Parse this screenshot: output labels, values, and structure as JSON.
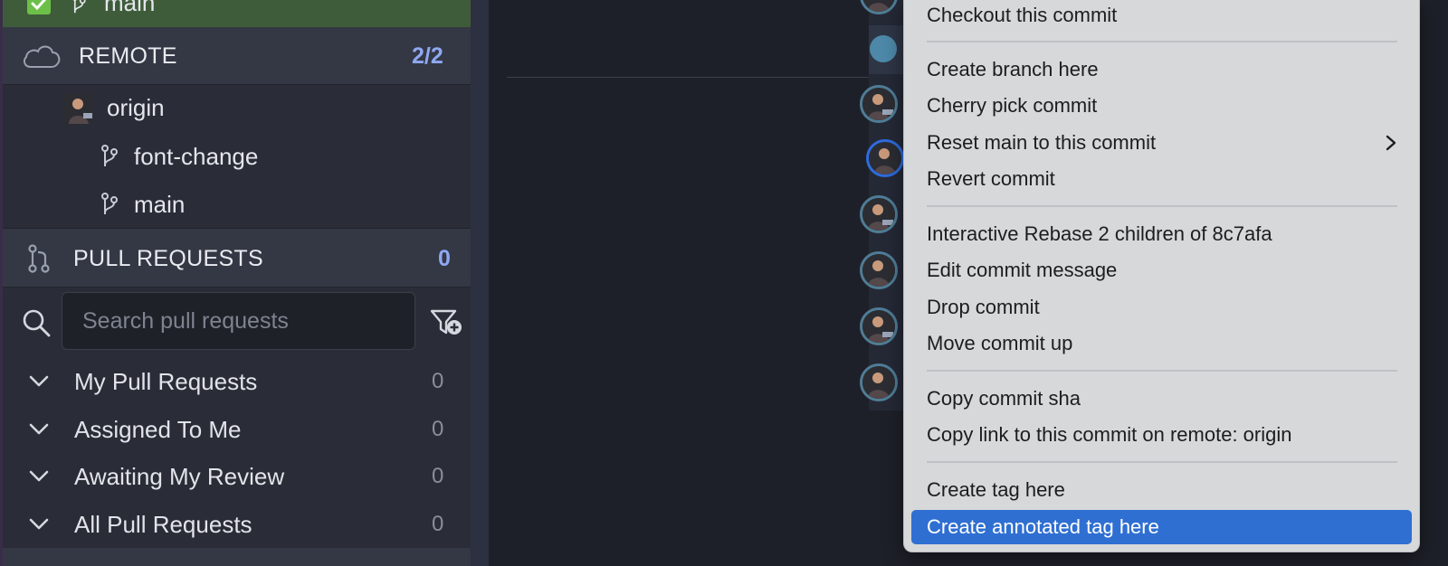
{
  "sidebar": {
    "local_branch": {
      "label": "main",
      "checked": true
    },
    "remote": {
      "label": "REMOTE",
      "count": "2/2"
    },
    "origin": {
      "label": "origin",
      "branches": [
        {
          "label": "font-change"
        },
        {
          "label": "main"
        }
      ]
    },
    "pull_requests": {
      "label": "PULL REQUESTS",
      "count": "0",
      "search_placeholder": "Search pull requests",
      "search_value": "",
      "groups": [
        {
          "label": "My Pull Requests",
          "count": "0"
        },
        {
          "label": "Assigned To Me",
          "count": "0"
        },
        {
          "label": "Awaiting My Review",
          "count": "0"
        },
        {
          "label": "All Pull Requests",
          "count": "0"
        }
      ]
    }
  },
  "context_menu": {
    "items": {
      "checkout": "Checkout this commit",
      "create_branch": "Create branch here",
      "cherry_pick": "Cherry pick commit",
      "reset": "Reset main to this commit",
      "revert": "Revert commit",
      "interactive_rebase": "Interactive Rebase 2 children of 8c7afa",
      "edit_message": "Edit commit message",
      "drop": "Drop commit",
      "move_up": "Move commit up",
      "copy_sha": "Copy commit sha",
      "copy_link": "Copy link to this commit on remote: origin",
      "create_tag": "Create tag here",
      "create_annotated_tag": "Create annotated tag here"
    },
    "highlighted": "create_annotated_tag"
  },
  "icons": {
    "checkbox": "check-icon",
    "branch": "branch-icon",
    "cloud": "cloud-icon",
    "pull_request": "pull-request-icon",
    "search": "search-icon",
    "filter_add": "filter-add-icon",
    "chevron_down": "chevron-down-icon",
    "chevron_right": "chevron-right-icon"
  },
  "colors": {
    "accent_count": "#8fa8f2",
    "local_branch_bg": "#3f5c3a",
    "menu_highlight": "#2f6fd2",
    "menu_bg": "#d7d8da",
    "sidebar_bg": "#2a2d38"
  }
}
